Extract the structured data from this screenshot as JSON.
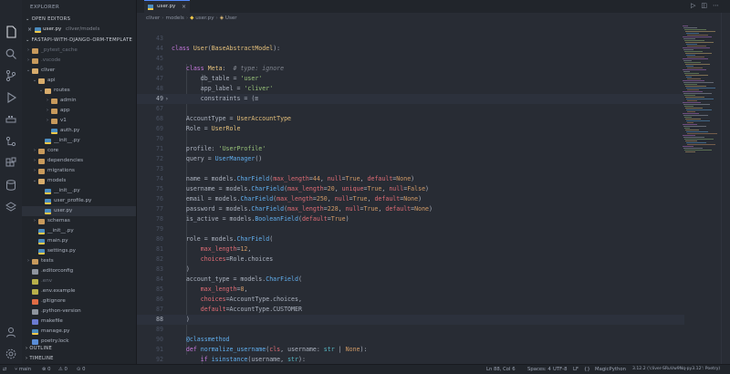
{
  "explorer": {
    "title": "EXPLORER",
    "open_editors_label": "OPEN EDITORS",
    "open_editor": {
      "name": "user.py",
      "path": "cliver/models"
    },
    "project_label": "FASTAPI-WITH-DJANGO-ORM-TEMPLATE",
    "tree": [
      {
        "label": "_pytest_cache",
        "icon": "folder",
        "depth": 1,
        "dim": true
      },
      {
        "label": ".vscode",
        "icon": "folder",
        "depth": 1,
        "dim": true
      },
      {
        "label": "cliver",
        "icon": "folder-open",
        "depth": 1
      },
      {
        "label": "api",
        "icon": "folder-open",
        "depth": 2
      },
      {
        "label": "routes",
        "icon": "folder-open",
        "depth": 3
      },
      {
        "label": "admin",
        "icon": "folder",
        "depth": 4
      },
      {
        "label": "app",
        "icon": "folder",
        "depth": 4
      },
      {
        "label": "v1",
        "icon": "folder",
        "depth": 4
      },
      {
        "label": "auth.py",
        "icon": "py",
        "depth": 4
      },
      {
        "label": "__init__.py",
        "icon": "py",
        "depth": 3
      },
      {
        "label": "core",
        "icon": "folder",
        "depth": 2
      },
      {
        "label": "dependencies",
        "icon": "folder",
        "depth": 2
      },
      {
        "label": "migrations",
        "icon": "folder",
        "depth": 2
      },
      {
        "label": "models",
        "icon": "folder-open",
        "depth": 2
      },
      {
        "label": "__init__.py",
        "icon": "py",
        "depth": 3
      },
      {
        "label": "user_profile.py",
        "icon": "py",
        "depth": 3
      },
      {
        "label": "user.py",
        "icon": "py",
        "depth": 3,
        "selected": true
      },
      {
        "label": "schemas",
        "icon": "folder",
        "depth": 2
      },
      {
        "label": "__init__.py",
        "icon": "py",
        "depth": 2
      },
      {
        "label": "main.py",
        "icon": "py",
        "depth": 2
      },
      {
        "label": "settings.py",
        "icon": "py",
        "depth": 2
      },
      {
        "label": "tests",
        "icon": "folder",
        "depth": 1
      },
      {
        "label": ".editorconfig",
        "icon": "gen",
        "depth": 1
      },
      {
        "label": ".env",
        "icon": "env",
        "depth": 1,
        "dim": true
      },
      {
        "label": ".env.example",
        "icon": "env",
        "depth": 1
      },
      {
        "label": ".gitignore",
        "icon": "git",
        "depth": 1
      },
      {
        "label": ".python-version",
        "icon": "gen",
        "depth": 1
      },
      {
        "label": "makefile",
        "icon": "mk",
        "depth": 1
      },
      {
        "label": "manage.py",
        "icon": "py",
        "depth": 1
      },
      {
        "label": "poetry.lock",
        "icon": "lock",
        "depth": 1
      }
    ],
    "outline_label": "OUTLINE",
    "timeline_label": "TIMELINE"
  },
  "activity_bar": [
    "files-icon",
    "search-icon",
    "source-control-icon",
    "run-debug-icon",
    "docker-icon",
    "git-graph-icon",
    "extensions-icon",
    "database-icon",
    "layers-icon",
    "account-icon",
    "settings-icon"
  ],
  "tab": {
    "label": "user.py",
    "close": "×"
  },
  "breadcrumb": [
    "cliver",
    "models",
    "user.py",
    "User"
  ],
  "code": [
    {
      "n": "43",
      "t": []
    },
    {
      "n": "44",
      "t": [
        [
          "k",
          "class "
        ],
        [
          "c",
          "User"
        ],
        [
          "t",
          "("
        ],
        [
          "c",
          "BaseAbstractModel"
        ],
        [
          "t",
          "):"
        ]
      ]
    },
    {
      "n": "45",
      "t": []
    },
    {
      "n": "46",
      "t": [
        [
          "t",
          "    "
        ],
        [
          "k",
          "class "
        ],
        [
          "c",
          "Meta"
        ],
        [
          "t",
          ":  "
        ],
        [
          "cm",
          "# type: ignore"
        ]
      ]
    },
    {
      "n": "47",
      "t": [
        [
          "t",
          "        db_table = "
        ],
        [
          "s",
          "'user'"
        ]
      ]
    },
    {
      "n": "48",
      "t": [
        [
          "t",
          "        app_label = "
        ],
        [
          "s",
          "'cliver'"
        ]
      ]
    },
    {
      "n": "49",
      "t": [
        [
          "t",
          "        constraints = (≡"
        ]
      ],
      "cur": true,
      "fold": true
    },
    {
      "n": "67",
      "t": []
    },
    {
      "n": "68",
      "t": [
        [
          "t",
          "    AccountType = "
        ],
        [
          "c",
          "UserAccountType"
        ]
      ]
    },
    {
      "n": "69",
      "t": [
        [
          "t",
          "    Role = "
        ],
        [
          "c",
          "UserRole"
        ]
      ]
    },
    {
      "n": "70",
      "t": []
    },
    {
      "n": "71",
      "t": [
        [
          "t",
          "    profile: "
        ],
        [
          "s",
          "'UserProfile'"
        ]
      ]
    },
    {
      "n": "72",
      "t": [
        [
          "t",
          "    query = "
        ],
        [
          "f",
          "UserManager"
        ],
        [
          "t",
          "()"
        ]
      ]
    },
    {
      "n": "73",
      "t": []
    },
    {
      "n": "74",
      "t": [
        [
          "t",
          "    name = models."
        ],
        [
          "f",
          "CharField"
        ],
        [
          "t",
          "("
        ],
        [
          "p",
          "max_length"
        ],
        [
          "t",
          "="
        ],
        [
          "n",
          "44"
        ],
        [
          "t",
          ", "
        ],
        [
          "p",
          "null"
        ],
        [
          "t",
          "="
        ],
        [
          "n",
          "True"
        ],
        [
          "t",
          ", "
        ],
        [
          "p",
          "default"
        ],
        [
          "t",
          "="
        ],
        [
          "n",
          "None"
        ],
        [
          "t",
          ")"
        ]
      ]
    },
    {
      "n": "75",
      "t": [
        [
          "t",
          "    username = models."
        ],
        [
          "f",
          "CharField"
        ],
        [
          "t",
          "("
        ],
        [
          "p",
          "max_length"
        ],
        [
          "t",
          "="
        ],
        [
          "n",
          "20"
        ],
        [
          "t",
          ", "
        ],
        [
          "p",
          "unique"
        ],
        [
          "t",
          "="
        ],
        [
          "n",
          "True"
        ],
        [
          "t",
          ", "
        ],
        [
          "p",
          "null"
        ],
        [
          "t",
          "="
        ],
        [
          "n",
          "False"
        ],
        [
          "t",
          ")"
        ]
      ]
    },
    {
      "n": "76",
      "t": [
        [
          "t",
          "    email = models."
        ],
        [
          "f",
          "CharField"
        ],
        [
          "t",
          "("
        ],
        [
          "p",
          "max_length"
        ],
        [
          "t",
          "="
        ],
        [
          "n",
          "250"
        ],
        [
          "t",
          ", "
        ],
        [
          "p",
          "null"
        ],
        [
          "t",
          "="
        ],
        [
          "n",
          "True"
        ],
        [
          "t",
          ", "
        ],
        [
          "p",
          "default"
        ],
        [
          "t",
          "="
        ],
        [
          "n",
          "None"
        ],
        [
          "t",
          ")"
        ]
      ]
    },
    {
      "n": "77",
      "t": [
        [
          "t",
          "    password = models."
        ],
        [
          "f",
          "CharField"
        ],
        [
          "t",
          "("
        ],
        [
          "p",
          "max_length"
        ],
        [
          "t",
          "="
        ],
        [
          "n",
          "228"
        ],
        [
          "t",
          ", "
        ],
        [
          "p",
          "null"
        ],
        [
          "t",
          "="
        ],
        [
          "n",
          "True"
        ],
        [
          "t",
          ", "
        ],
        [
          "p",
          "default"
        ],
        [
          "t",
          "="
        ],
        [
          "n",
          "None"
        ],
        [
          "t",
          ")"
        ]
      ]
    },
    {
      "n": "78",
      "t": [
        [
          "t",
          "    is_active = models."
        ],
        [
          "f",
          "BooleanField"
        ],
        [
          "t",
          "("
        ],
        [
          "p",
          "default"
        ],
        [
          "t",
          "="
        ],
        [
          "n",
          "True"
        ],
        [
          "t",
          ")"
        ]
      ]
    },
    {
      "n": "79",
      "t": []
    },
    {
      "n": "80",
      "t": [
        [
          "t",
          "    role = models."
        ],
        [
          "f",
          "CharField"
        ],
        [
          "t",
          "("
        ]
      ]
    },
    {
      "n": "81",
      "t": [
        [
          "t",
          "        "
        ],
        [
          "p",
          "max_length"
        ],
        [
          "t",
          "="
        ],
        [
          "n",
          "12"
        ],
        [
          "t",
          ","
        ]
      ]
    },
    {
      "n": "82",
      "t": [
        [
          "t",
          "        "
        ],
        [
          "p",
          "choices"
        ],
        [
          "t",
          "=Role.choices"
        ]
      ]
    },
    {
      "n": "83",
      "t": [
        [
          "t",
          "    )"
        ]
      ]
    },
    {
      "n": "84",
      "t": [
        [
          "t",
          "    account_type = models."
        ],
        [
          "f",
          "CharField"
        ],
        [
          "t",
          "("
        ]
      ]
    },
    {
      "n": "85",
      "t": [
        [
          "t",
          "        "
        ],
        [
          "p",
          "max_length"
        ],
        [
          "t",
          "="
        ],
        [
          "n",
          "8"
        ],
        [
          "t",
          ","
        ]
      ]
    },
    {
      "n": "86",
      "t": [
        [
          "t",
          "        "
        ],
        [
          "p",
          "choices"
        ],
        [
          "t",
          "=AccountType.choices,"
        ]
      ]
    },
    {
      "n": "87",
      "t": [
        [
          "t",
          "        "
        ],
        [
          "p",
          "default"
        ],
        [
          "t",
          "=AccountType.CUSTOMER"
        ]
      ]
    },
    {
      "n": "88",
      "t": [
        [
          "t",
          "    )"
        ]
      ],
      "cur": true
    },
    {
      "n": "89",
      "t": []
    },
    {
      "n": "90",
      "t": [
        [
          "t",
          "    "
        ],
        [
          "d",
          "@classmethod"
        ]
      ]
    },
    {
      "n": "91",
      "t": [
        [
          "t",
          "    "
        ],
        [
          "k",
          "def "
        ],
        [
          "f",
          "normalize_username"
        ],
        [
          "t",
          "("
        ],
        [
          "p",
          "cls"
        ],
        [
          "t",
          ", username: "
        ],
        [
          "o",
          "str"
        ],
        [
          "t",
          " | "
        ],
        [
          "n",
          "None"
        ],
        [
          "t",
          "):"
        ]
      ]
    },
    {
      "n": "92",
      "t": [
        [
          "t",
          "        "
        ],
        [
          "k",
          "if "
        ],
        [
          "f",
          "isinstance"
        ],
        [
          "t",
          "(username, "
        ],
        [
          "o",
          "str"
        ],
        [
          "t",
          "):"
        ]
      ]
    },
    {
      "n": "93",
      "t": [
        [
          "t",
          "            "
        ],
        [
          "k",
          "return "
        ],
        [
          "t",
          "unicodedata."
        ],
        [
          "f",
          "normalize"
        ],
        [
          "t",
          "("
        ],
        [
          "s",
          "'NFKC'"
        ],
        [
          "t",
          ", username)"
        ]
      ]
    }
  ],
  "status": {
    "branch": "main",
    "errors": "0",
    "warnings": "0",
    "ports": "0",
    "position": "Ln 88, Col 6",
    "spaces": "Spaces: 4",
    "encoding": "UTF-8",
    "eol": "LF",
    "language": "MagicPython",
    "interpreter": "3.12.2 ('cliver-SRuVw9Nq-py3.12': Poetry)"
  },
  "colors": {
    "accent": "#528bff",
    "background": "#282c34",
    "sidebar": "#21252b"
  }
}
